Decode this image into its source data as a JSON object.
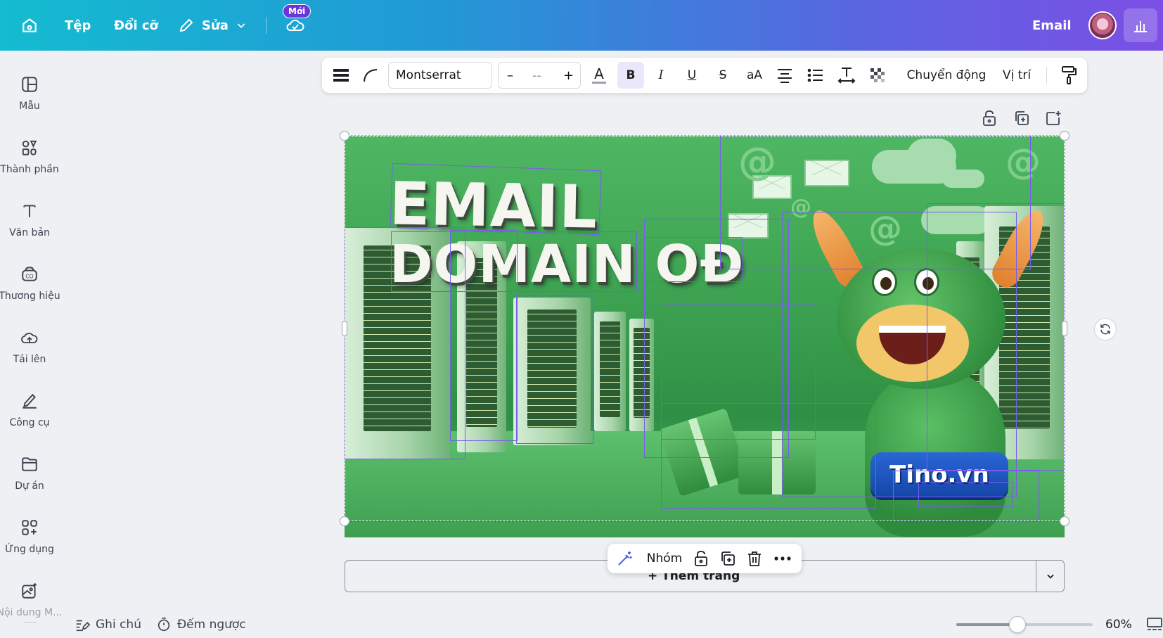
{
  "topbar": {
    "home_icon": "home-icon",
    "file_label": "Tệp",
    "resize_label": "Đổi cỡ",
    "edit_label": "Sửa",
    "save_icon": "cloud-check-icon",
    "new_badge": "Mới",
    "doc_title": "Email",
    "avatar_icon": "avatar",
    "stats_icon": "bar-chart-icon"
  },
  "sidebar": {
    "items": [
      {
        "label": "Mẫu",
        "icon": "template-icon"
      },
      {
        "label": "Thành phần",
        "icon": "elements-icon"
      },
      {
        "label": "Văn bản",
        "icon": "text-icon"
      },
      {
        "label": "Thương hiệu",
        "icon": "brand-icon"
      },
      {
        "label": "Tải lên",
        "icon": "upload-icon"
      },
      {
        "label": "Công cụ",
        "icon": "tools-icon"
      },
      {
        "label": "Dự án",
        "icon": "folder-icon"
      },
      {
        "label": "Ứng dụng",
        "icon": "apps-icon"
      },
      {
        "label": "Nội dung M...",
        "icon": "magic-media-icon"
      }
    ]
  },
  "format_toolbar": {
    "font_name": "Montserrat",
    "font_size": "--",
    "minus": "–",
    "plus": "+",
    "bold": "B",
    "italic": "I",
    "underline": "U",
    "strike": "S",
    "case": "aA",
    "animate_label": "Chuyển động",
    "position_label": "Vị trí"
  },
  "canvas": {
    "headline_line1": "EMAIL",
    "headline_line2": "DOMAIN OĐ",
    "brand_button": "Tino.vn",
    "colors": {
      "accent": "#7a5cf0",
      "banner_green": "#3aa04f",
      "brand_blue": "#1d55c0"
    }
  },
  "add_page": {
    "label": "+ Thêm trang"
  },
  "group_toolbar": {
    "group_label": "Nhóm"
  },
  "bottombar": {
    "notes_label": "Ghi chú",
    "timer_label": "Đếm ngược",
    "zoom_level": "60%",
    "zoom_fraction": 0.45
  }
}
